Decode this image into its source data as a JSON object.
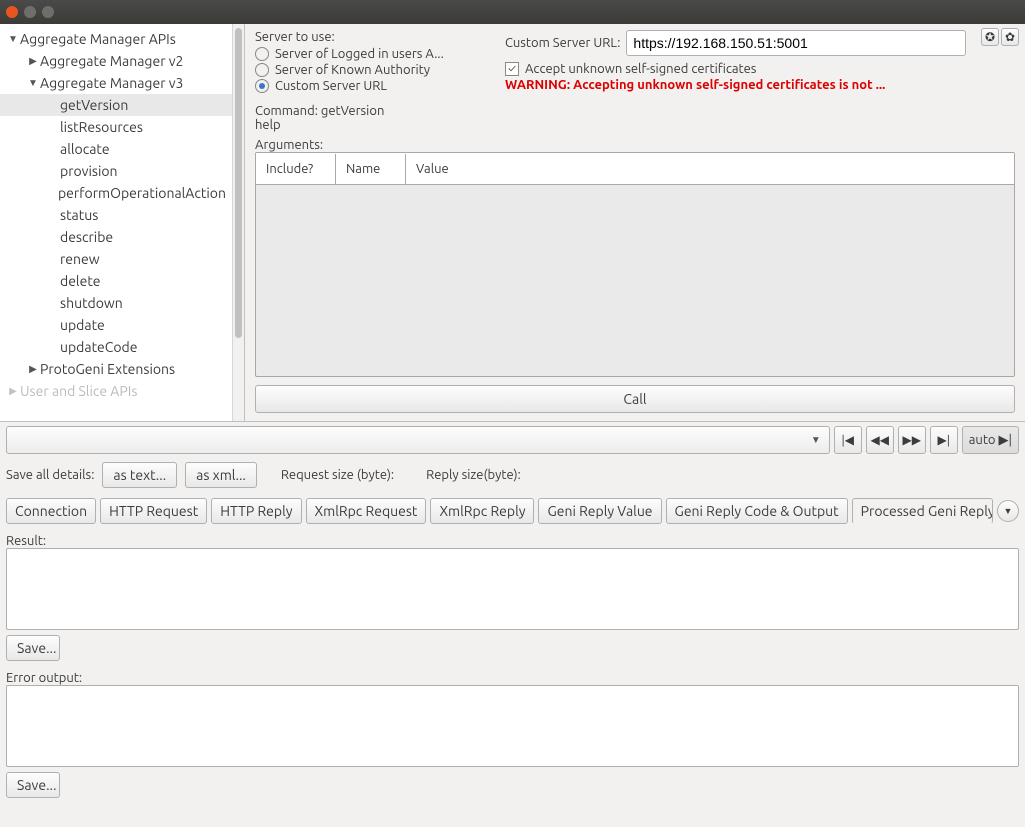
{
  "tree": {
    "root": "Aggregate Manager APIs",
    "v2": "Aggregate Manager v2",
    "v3": "Aggregate Manager v3",
    "items": [
      "getVersion",
      "listResources",
      "allocate",
      "provision",
      "performOperationalAction",
      "status",
      "describe",
      "renew",
      "delete",
      "shutdown",
      "update",
      "updateCode"
    ],
    "protogeni": "ProtoGeni Extensions",
    "userslice": "User and Slice APIs"
  },
  "server": {
    "label": "Server to use:",
    "opt_logged": "Server of Logged in users A...",
    "opt_known": "Server of Known Authority",
    "opt_custom": "Custom Server URL",
    "url_label": "Custom Server URL:",
    "url_value": "https://192.168.150.51:5001",
    "accept_cb": "Accept unknown self-signed certificates",
    "warning": "WARNING: Accepting unknown self-signed certificates is not ..."
  },
  "command": {
    "line": "Command: getVersion",
    "help": "help"
  },
  "args": {
    "label": "Arguments:",
    "h_include": "Include?",
    "h_name": "Name",
    "h_value": "Value"
  },
  "call_label": "Call",
  "save_details": {
    "label": "Save all details:",
    "as_text": "as text...",
    "as_xml": "as xml...",
    "req_size": "Request size (byte):",
    "reply_size": "Reply size(byte):"
  },
  "nav": {
    "auto": "auto"
  },
  "tabs": [
    "Connection",
    "HTTP Request",
    "HTTP Reply",
    "XmlRpc Request",
    "XmlRpc Reply",
    "Geni Reply Value",
    "Geni Reply Code & Output",
    "Processed Geni Reply V"
  ],
  "result": {
    "label": "Result:",
    "save": "Save..."
  },
  "error": {
    "label": "Error output:",
    "save": "Save..."
  }
}
